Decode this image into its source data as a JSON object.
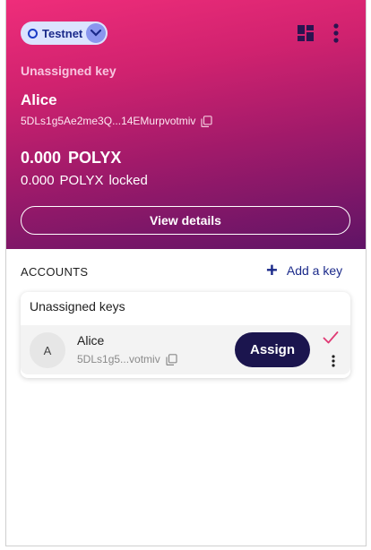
{
  "network": {
    "label": "Testnet"
  },
  "selected_account": {
    "key_status": "Unassigned key",
    "name": "Alice",
    "address": "5DLs1g5Ae2me3Q...14EMurpvotmiv",
    "balance_amount": "0.000",
    "balance_ticker": "POLYX",
    "locked_amount": "0.000",
    "locked_ticker": "POLYX",
    "locked_label": "locked",
    "view_details_label": "View details"
  },
  "accounts": {
    "header": "ACCOUNTS",
    "add_key_label": "Add a key",
    "groups": [
      {
        "title": "Unassigned keys",
        "items": [
          {
            "avatar_letter": "A",
            "name": "Alice",
            "address": "5DLs1g5...votmiv",
            "assign_label": "Assign"
          }
        ]
      }
    ]
  },
  "colors": {
    "hero_gradient_start": "#ef2d7a",
    "hero_gradient_end": "#5f1466",
    "primary_dark": "#1b154e",
    "link_blue": "#1b2a8a",
    "check_pink": "#e03a74"
  },
  "icons": [
    "network-dot-icon",
    "chevron-down-icon",
    "dashboard-grid-icon",
    "more-vertical-icon",
    "copy-icon",
    "plus-icon",
    "check-icon"
  ]
}
